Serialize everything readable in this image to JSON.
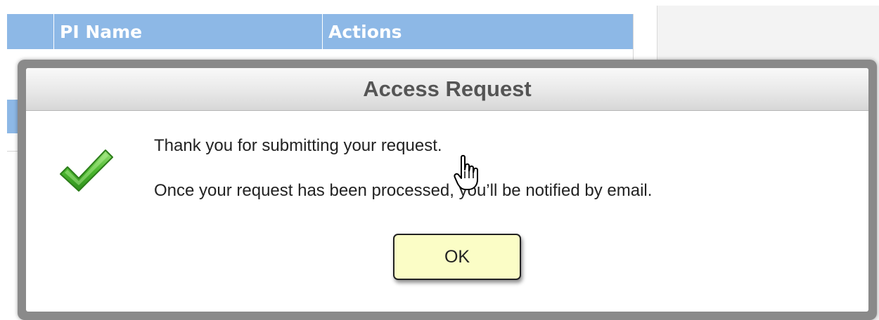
{
  "background": {
    "table": {
      "columns": [
        "",
        "PI Name",
        "Actions"
      ],
      "header_color": "#8db8e6"
    }
  },
  "dialog": {
    "title": "Access Request",
    "icon": "checkmark-icon",
    "messages": [
      "Thank you for submitting your request.",
      "Once your request has been processed, you’ll be notified by email."
    ],
    "ok_label": "OK",
    "ok_button_color": "#fbfdc6",
    "frame_color": "#8a8a8a"
  },
  "cursor": "hand-pointer-icon"
}
